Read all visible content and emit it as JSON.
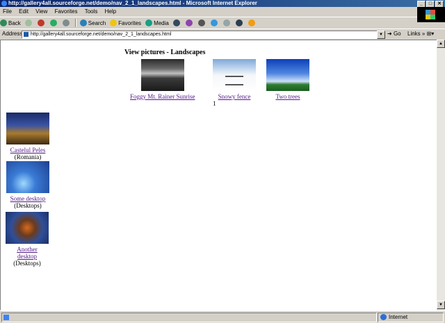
{
  "window": {
    "title": "http://gallery4all.sourceforge.net/demo/nav_2_1_landscapes.html - Microsoft Internet Explorer",
    "controls": [
      "_",
      "□",
      "✕"
    ]
  },
  "menu": [
    "File",
    "Edit",
    "View",
    "Favorites",
    "Tools",
    "Help"
  ],
  "toolbar": {
    "back_label": "Back",
    "search_label": "Search",
    "favorites_label": "Favorites",
    "media_label": "Media"
  },
  "address": {
    "label": "Address",
    "url": "http://gallery4all.sourceforge.net/demo/nav_2_1_landscapes.html",
    "go_label": "Go",
    "links_label": "Links"
  },
  "page": {
    "heading": "View pictures - Landscapes",
    "thumbnails": [
      {
        "caption": "Foggy Mt. Rainer Sunrise"
      },
      {
        "caption": "Snowy fence"
      },
      {
        "caption": "Two trees"
      }
    ],
    "page_number": "1",
    "sidebar": [
      {
        "caption": "Castelul Peles",
        "category": "(Romania)"
      },
      {
        "caption": "Some desktop",
        "category": "(Desktops)"
      },
      {
        "caption": "Another desktop",
        "category": "(Desktops)"
      }
    ]
  },
  "status": {
    "zone": "Internet"
  }
}
